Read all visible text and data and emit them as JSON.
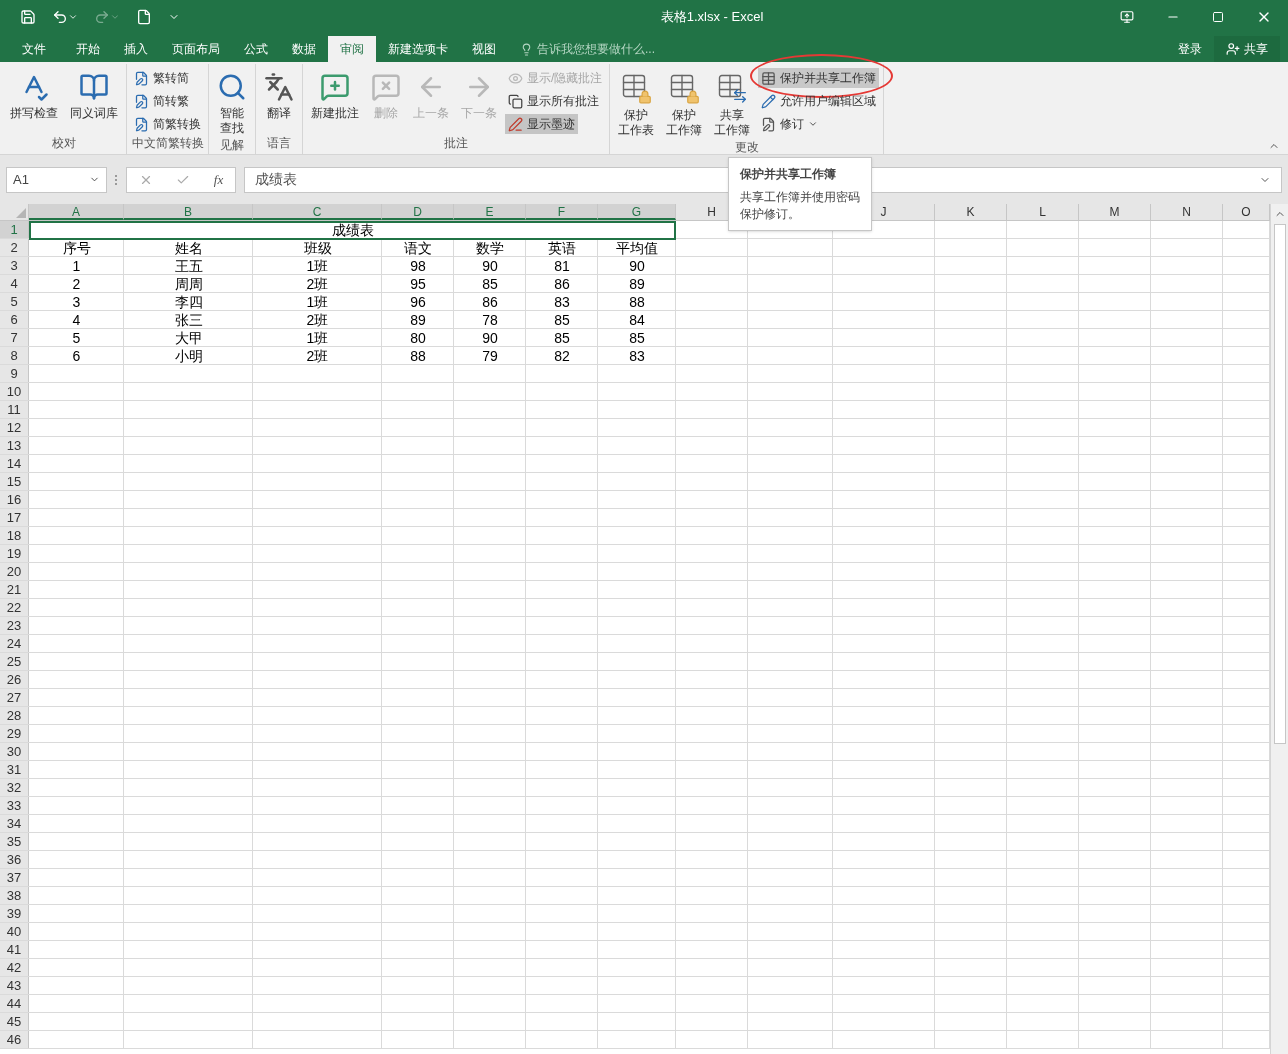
{
  "window": {
    "title": "表格1.xlsx - Excel"
  },
  "account": {
    "sign_in": "登录",
    "share": "共享"
  },
  "tabs": [
    {
      "label": "文件",
      "selected": false
    },
    {
      "label": "开始",
      "selected": false
    },
    {
      "label": "插入",
      "selected": false
    },
    {
      "label": "页面布局",
      "selected": false
    },
    {
      "label": "公式",
      "selected": false
    },
    {
      "label": "数据",
      "selected": false
    },
    {
      "label": "审阅",
      "selected": true
    },
    {
      "label": "新建选项卡",
      "selected": false
    },
    {
      "label": "视图",
      "selected": false
    }
  ],
  "tell_me": {
    "placeholder": "告诉我您想要做什么..."
  },
  "ribbon": [
    {
      "name": "校对",
      "items": [
        {
          "kind": "large",
          "lines": [
            "拼写检查"
          ],
          "disabled": false
        },
        {
          "kind": "large",
          "lines": [
            "同义词库"
          ],
          "disabled": false
        }
      ]
    },
    {
      "name": "中文简繁转换",
      "items": [
        {
          "kind": "small",
          "label": "繁转简",
          "disabled": false
        },
        {
          "kind": "small",
          "label": "简转繁",
          "disabled": false
        },
        {
          "kind": "small",
          "label": "简繁转换",
          "disabled": false
        }
      ]
    },
    {
      "name": "见解",
      "items": [
        {
          "kind": "large",
          "lines": [
            "智能",
            "查找"
          ],
          "disabled": false
        }
      ]
    },
    {
      "name": "语言",
      "items": [
        {
          "kind": "large",
          "lines": [
            "翻译"
          ],
          "disabled": false
        }
      ]
    },
    {
      "name": "批注",
      "items": [
        {
          "kind": "large",
          "lines": [
            "新建批注"
          ],
          "disabled": false
        },
        {
          "kind": "large",
          "lines": [
            "删除"
          ],
          "disabled": true
        },
        {
          "kind": "large",
          "lines": [
            "上一条"
          ],
          "disabled": true
        },
        {
          "kind": "large",
          "lines": [
            "下一条"
          ],
          "disabled": true
        },
        {
          "kind": "small",
          "label": "显示/隐藏批注",
          "disabled": true
        },
        {
          "kind": "small",
          "label": "显示所有批注",
          "disabled": false
        },
        {
          "kind": "small",
          "label": "显示墨迹",
          "disabled": false,
          "pressed": true
        }
      ]
    },
    {
      "name": "更改",
      "items": [
        {
          "kind": "large",
          "lines": [
            "保护",
            "工作表"
          ],
          "disabled": false
        },
        {
          "kind": "large",
          "lines": [
            "保护",
            "工作簿"
          ],
          "disabled": false
        },
        {
          "kind": "large",
          "lines": [
            "共享",
            "工作簿"
          ],
          "disabled": false
        },
        {
          "kind": "small",
          "label": "保护并共享工作簿",
          "disabled": false,
          "hovered": true,
          "circled": true
        },
        {
          "kind": "small",
          "label": "允许用户编辑区域",
          "disabled": false
        },
        {
          "kind": "small",
          "label": "修订",
          "disabled": false,
          "dropdown": true
        }
      ]
    }
  ],
  "formula_bar": {
    "name_box": "A1",
    "function_label": "fx",
    "formula": "成绩表"
  },
  "tooltip": {
    "title": "保护并共享工作簿",
    "description": "共享工作簿并使用密码保护修订。"
  },
  "sheet": {
    "columns": [
      {
        "label": "A",
        "selected": true
      },
      {
        "label": "B",
        "selected": true
      },
      {
        "label": "C",
        "selected": true
      },
      {
        "label": "D",
        "selected": true
      },
      {
        "label": "E",
        "selected": true
      },
      {
        "label": "F",
        "selected": true
      },
      {
        "label": "G",
        "selected": true
      },
      {
        "label": "H",
        "selected": false
      },
      {
        "label": "J",
        "selected": false
      },
      {
        "label": "K",
        "selected": false
      },
      {
        "label": "L",
        "selected": false
      },
      {
        "label": "M",
        "selected": false
      },
      {
        "label": "N",
        "selected": false
      },
      {
        "label": "O",
        "selected": false
      }
    ],
    "title": "成绩表",
    "header": [
      "序号",
      "姓名",
      "班级",
      "语文",
      "数学",
      "英语",
      "平均值"
    ],
    "rows": [
      [
        "1",
        "王五",
        "1班",
        "98",
        "90",
        "81",
        "90"
      ],
      [
        "2",
        "周周",
        "2班",
        "95",
        "85",
        "86",
        "89"
      ],
      [
        "3",
        "李四",
        "1班",
        "96",
        "86",
        "83",
        "88"
      ],
      [
        "4",
        "张三",
        "2班",
        "89",
        "78",
        "85",
        "84"
      ],
      [
        "5",
        "大甲",
        "1班",
        "80",
        "90",
        "85",
        "85"
      ],
      [
        "6",
        "小明",
        "2班",
        "88",
        "79",
        "82",
        "83"
      ]
    ],
    "row_headers": [
      {
        "label": "1",
        "selected": true
      },
      {
        "label": "2",
        "selected": false
      },
      {
        "label": "3",
        "selected": false
      },
      {
        "label": "4",
        "selected": false
      },
      {
        "label": "5",
        "selected": false
      },
      {
        "label": "6",
        "selected": false
      },
      {
        "label": "7",
        "selected": false
      },
      {
        "label": "8",
        "selected": false
      },
      {
        "label": "9",
        "selected": false
      },
      {
        "label": "10",
        "selected": false
      },
      {
        "label": "11",
        "selected": false
      },
      {
        "label": "12",
        "selected": false
      },
      {
        "label": "13",
        "selected": false
      },
      {
        "label": "14",
        "selected": false
      },
      {
        "label": "15",
        "selected": false
      },
      {
        "label": "16",
        "selected": false
      },
      {
        "label": "17",
        "selected": false
      },
      {
        "label": "18",
        "selected": false
      },
      {
        "label": "19",
        "selected": false
      },
      {
        "label": "20",
        "selected": false
      },
      {
        "label": "21",
        "selected": false
      },
      {
        "label": "22",
        "selected": false
      },
      {
        "label": "23",
        "selected": false
      },
      {
        "label": "24",
        "selected": false
      },
      {
        "label": "25",
        "selected": false
      },
      {
        "label": "26",
        "selected": false
      },
      {
        "label": "27",
        "selected": false
      },
      {
        "label": "28",
        "selected": false
      },
      {
        "label": "29",
        "selected": false
      },
      {
        "label": "30",
        "selected": false
      },
      {
        "label": "31",
        "selected": false
      },
      {
        "label": "32",
        "selected": false
      },
      {
        "label": "33",
        "selected": false
      },
      {
        "label": "34",
        "selected": false
      },
      {
        "label": "35",
        "selected": false
      },
      {
        "label": "36",
        "selected": false
      },
      {
        "label": "37",
        "selected": false
      },
      {
        "label": "38",
        "selected": false
      },
      {
        "label": "39",
        "selected": false
      },
      {
        "label": "40",
        "selected": false
      },
      {
        "label": "41",
        "selected": false
      },
      {
        "label": "42",
        "selected": false
      },
      {
        "label": "43",
        "selected": false
      },
      {
        "label": "44",
        "selected": false
      },
      {
        "label": "45",
        "selected": false
      },
      {
        "label": "46",
        "selected": false
      }
    ]
  }
}
